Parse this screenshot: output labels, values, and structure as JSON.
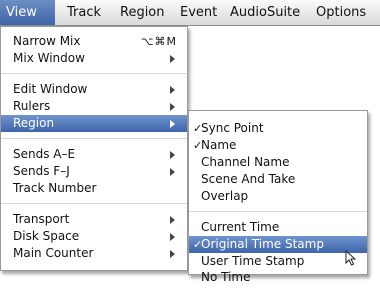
{
  "menubar": {
    "items": [
      "View",
      "Track",
      "Region",
      "Event",
      "AudioSuite",
      "Options"
    ],
    "active_index": 0
  },
  "view_menu": {
    "groups": [
      [
        {
          "label": "Narrow Mix",
          "shortcut": "⌥⌘M"
        },
        {
          "label": "Mix Window",
          "submenu": true
        }
      ],
      [
        {
          "label": "Edit Window",
          "submenu": true
        },
        {
          "label": "Rulers",
          "submenu": true
        },
        {
          "label": "Region",
          "submenu": true,
          "highlighted": true
        }
      ],
      [
        {
          "label": "Sends A–E",
          "submenu": true
        },
        {
          "label": "Sends F–J",
          "submenu": true
        },
        {
          "label": "Track Number"
        }
      ],
      [
        {
          "label": "Transport",
          "submenu": true
        },
        {
          "label": "Disk Space",
          "submenu": true
        },
        {
          "label": "Main Counter",
          "submenu": true
        }
      ]
    ]
  },
  "region_submenu": {
    "groups": [
      [
        {
          "label": "Sync Point",
          "checked": true
        },
        {
          "label": "Name",
          "checked": true
        },
        {
          "label": "Channel Name"
        },
        {
          "label": "Scene And Take"
        },
        {
          "label": "Overlap"
        }
      ],
      [
        {
          "label": "Current Time"
        },
        {
          "label": "Original Time Stamp",
          "checked": true,
          "highlighted": true
        },
        {
          "label": "User Time Stamp"
        },
        {
          "label": "No Time"
        }
      ]
    ],
    "checkmark": "✓"
  },
  "colors": {
    "highlight": "#3e65ab",
    "menubar": "#e6e6e6"
  }
}
